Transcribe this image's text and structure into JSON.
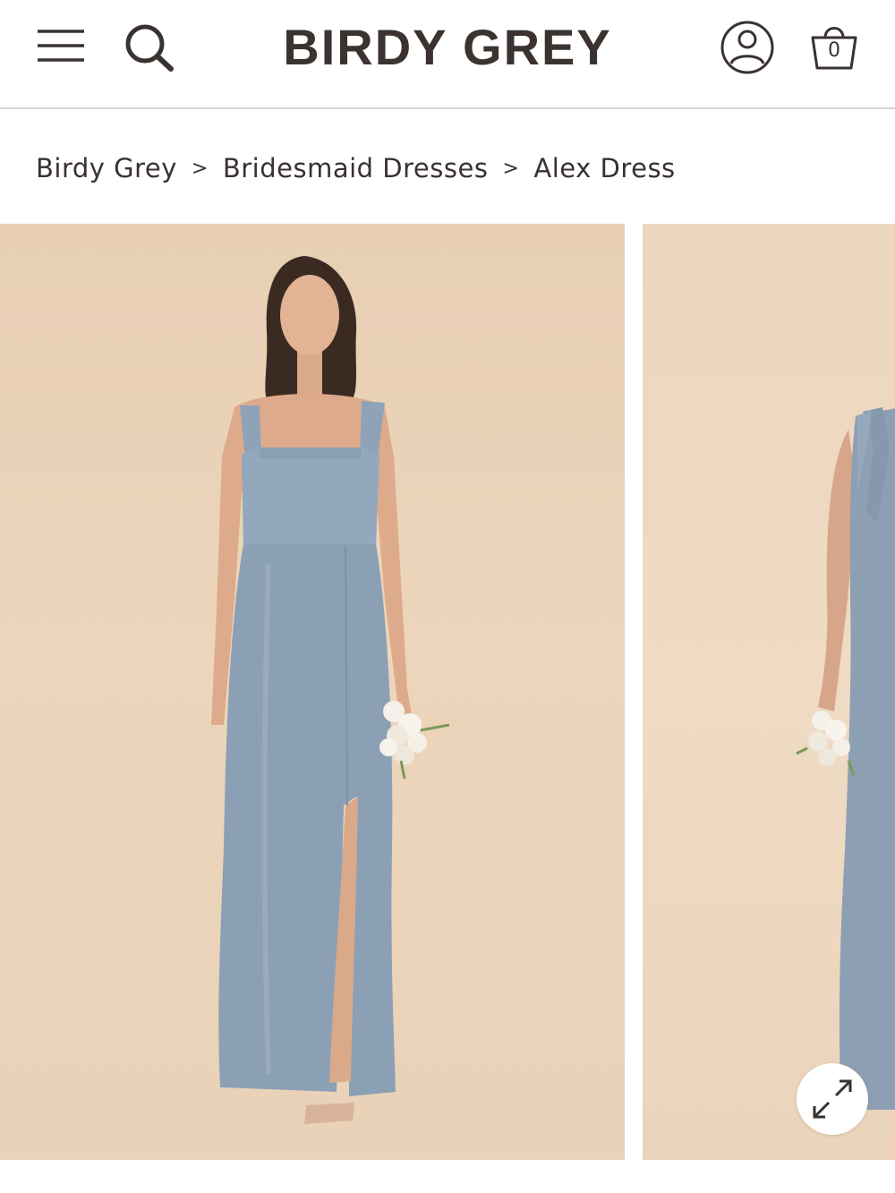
{
  "header": {
    "brand": "BIRDY GREY",
    "cart_count": "0",
    "icons": [
      "menu-icon",
      "search-icon",
      "account-icon",
      "cart-icon"
    ]
  },
  "breadcrumb": {
    "items": [
      "Birdy Grey",
      "Bridesmaid Dresses",
      "Alex Dress"
    ],
    "separator": ">"
  },
  "gallery": {
    "slides": [
      {
        "subject": "model in dusty blue satin square-neck gown with leg slit holding white flower bouquet"
      },
      {
        "subject": "model in dusty blue satin gown with tie strap holding white flower bouquet (partially visible)"
      }
    ],
    "expand_icon": "expand-arrows-icon"
  },
  "colors": {
    "text": "#3a3230",
    "backdrop": "#ebd3b9",
    "dress": "#8ea2b8",
    "divider": "#d9d6d3"
  }
}
